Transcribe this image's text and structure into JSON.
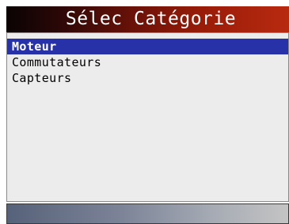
{
  "header": {
    "title": "Sélec Catégorie"
  },
  "menu": {
    "items": [
      {
        "label": "Moteur",
        "selected": true
      },
      {
        "label": "Commutateurs",
        "selected": false
      },
      {
        "label": "Capteurs",
        "selected": false
      }
    ]
  },
  "colors": {
    "selection": "#2731a8",
    "title_bar": "#9a1c08",
    "list_background": "#ececec"
  }
}
